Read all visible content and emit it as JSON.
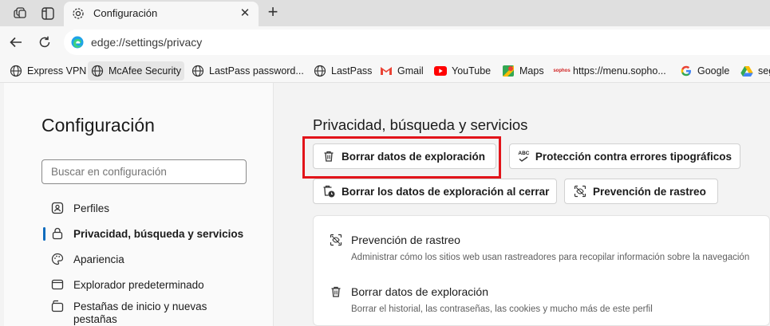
{
  "tab": {
    "title": "Configuración",
    "close": "✕",
    "new": "+"
  },
  "address": {
    "url": "edge://settings/privacy"
  },
  "favorites": [
    {
      "label": "Express VPN",
      "icon": "globe-icon"
    },
    {
      "label": "McAfee Security",
      "icon": "globe-icon"
    },
    {
      "label": "LastPass password...",
      "icon": "globe-icon"
    },
    {
      "label": "LastPass",
      "icon": "globe-icon"
    },
    {
      "label": "Gmail",
      "icon": "gmail-icon"
    },
    {
      "label": "YouTube",
      "icon": "youtube-icon"
    },
    {
      "label": "Maps",
      "icon": "maps-icon"
    },
    {
      "label": "https://menu.sopho...",
      "icon": "sophos-icon",
      "icon_text": "sophos"
    },
    {
      "label": "Google",
      "icon": "google-icon"
    },
    {
      "label": "seg",
      "icon": "drive-icon"
    }
  ],
  "sidebar": {
    "title": "Configuración",
    "search_placeholder": "Buscar en configuración",
    "items": [
      {
        "label": "Perfiles",
        "icon": "profile-icon"
      },
      {
        "label": "Privacidad, búsqueda y servicios",
        "icon": "lock-icon",
        "selected": true
      },
      {
        "label": "Apariencia",
        "icon": "palette-icon"
      },
      {
        "label": "Explorador predeterminado",
        "icon": "browser-icon"
      },
      {
        "label": "Pestañas de inicio y nuevas",
        "label_line2": "pestañas",
        "icon": "tabs-icon"
      }
    ]
  },
  "main": {
    "title": "Privacidad, búsqueda y servicios",
    "chips": [
      {
        "label": "Borrar datos de exploración",
        "icon": "trash-icon",
        "highlighted": true
      },
      {
        "label": "Protección contra errores tipográficos",
        "icon": "spellcheck-icon",
        "icon_text": "ABC"
      },
      {
        "label": "Borrar los datos de exploración al cerrar",
        "icon": "trash-clock-icon"
      },
      {
        "label": "Prevención de rastreo",
        "icon": "tracking-icon"
      }
    ],
    "card_rows": [
      {
        "title": "Prevención de rastreo",
        "desc": "Administrar cómo los sitios web usan rastreadores para recopilar información sobre la navegación",
        "icon": "tracking-icon"
      },
      {
        "title": "Borrar datos de exploración",
        "desc": "Borrar el historial, las contraseñas, las cookies y mucho más de este perfil",
        "icon": "trash-icon"
      }
    ]
  },
  "colors": {
    "accent": "#0f6cbd",
    "highlight": "#e2141a",
    "youtube": "#ff0000",
    "gmail": "#ea4335"
  }
}
